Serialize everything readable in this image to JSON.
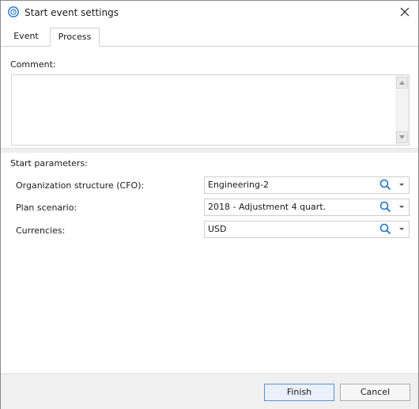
{
  "window": {
    "title": "Start event settings",
    "close_glyph": "✕"
  },
  "tabs": [
    {
      "label": "Event",
      "selected": false
    },
    {
      "label": "Process",
      "selected": true
    }
  ],
  "comment": {
    "label": "Comment:",
    "value": ""
  },
  "params": {
    "section_label": "Start parameters:",
    "rows": [
      {
        "label": "Organization structure (CFO):",
        "value": "Engineering-2"
      },
      {
        "label": "Plan scenario:",
        "value": "2018 - Adjustment 4 quart."
      },
      {
        "label": "Currencies:",
        "value": "USD"
      }
    ]
  },
  "footer": {
    "finish_label": "Finish",
    "cancel_label": "Cancel"
  },
  "colors": {
    "accent": "#1e74c8",
    "search_icon": "#1e74c8"
  },
  "icons": {
    "title": "clock-icon",
    "close": "close-icon",
    "search": "search-icon",
    "dropdown": "chevron-down-icon",
    "scroll_up": "scroll-up-arrow-icon",
    "scroll_down": "scroll-down-arrow-icon"
  }
}
